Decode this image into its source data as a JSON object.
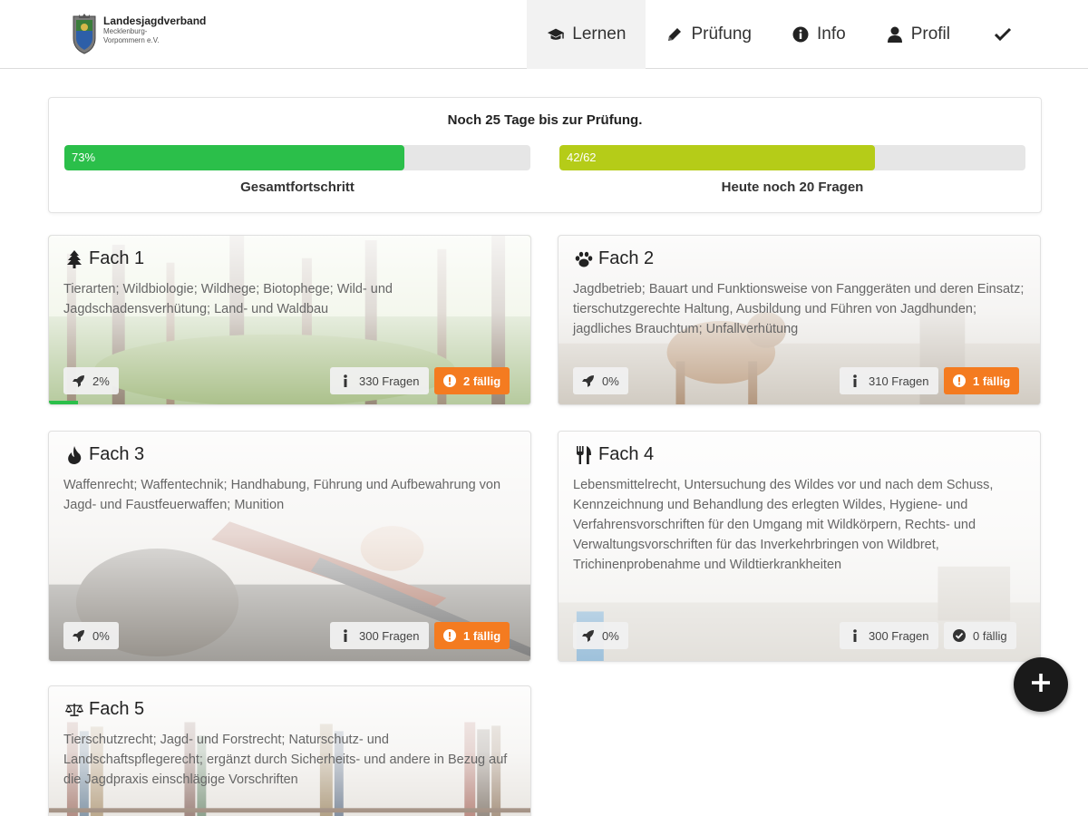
{
  "header": {
    "logo_title": "Landesjagdverband",
    "logo_sub_1": "Mecklenburg-",
    "logo_sub_2": "Vorpommern e.V.",
    "nav": [
      {
        "label": "Lernen",
        "icon": "graduation-cap-icon",
        "active": true
      },
      {
        "label": "Prüfung",
        "icon": "pencil-icon"
      },
      {
        "label": "Info",
        "icon": "info-circle-icon"
      },
      {
        "label": "Profil",
        "icon": "user-icon"
      }
    ],
    "check_icon": "check-icon"
  },
  "status": {
    "title": "Noch 25 Tage bis zur Prüfung.",
    "overall": {
      "text": "73%",
      "fraction": 0.73,
      "label": "Gesamtfortschritt",
      "color": "#2bbf4a"
    },
    "today": {
      "text": "42/62",
      "fraction": 0.677,
      "label": "Heute noch 20 Fragen",
      "color": "#b5cc18"
    }
  },
  "cards": [
    {
      "title": "Fach 1",
      "icon": "tree-icon",
      "desc": "Tierarten; Wildbiologie; Wildhege; Biotophege; Wild- und Jagdschadensverhütung; Land- und Waldbau",
      "progress": "2%",
      "progress_fraction": 0.02,
      "questions": "330 Fragen",
      "due": "2 fällig",
      "due_state": "warn",
      "bg": "forest"
    },
    {
      "title": "Fach 2",
      "icon": "paw-icon",
      "desc": "Jagdbetrieb; Bauart und Funktionsweise von Fanggeräten und deren Einsatz; tierschutzgerechte Haltung, Ausbildung und Führen von Jagdhunden; jagdliches Brauchtum; Unfallverhütung",
      "progress": "0%",
      "progress_fraction": 0,
      "questions": "310 Fragen",
      "due": "1 fällig",
      "due_state": "warn",
      "bg": "dog"
    },
    {
      "title": "Fach 3",
      "icon": "fire-icon",
      "desc": "Waffenrecht; Waffentechnik; Handhabung, Führung und Aufbewahrung von Jagd- und Faustfeuerwaffen; Munition",
      "progress": "0%",
      "progress_fraction": 0,
      "questions": "300 Fragen",
      "due": "1 fällig",
      "due_state": "warn",
      "bg": "rifle"
    },
    {
      "title": "Fach 4",
      "icon": "cutlery-icon",
      "desc": "Lebensmittelrecht, Untersuchung des Wildes vor und nach dem Schuss, Kennzeichnung und Behandlung des erlegten Wildes, Hygiene- und Verfahrensvorschriften für den Umgang mit Wildkörpern, Rechts- und Verwaltungsvorschriften für das Inverkehrbringen von Wildbret, Trichinenprobenahme und Wildtierkrankheiten",
      "progress": "0%",
      "progress_fraction": 0,
      "questions": "300 Fragen",
      "due": "0 fällig",
      "due_state": "ok",
      "bg": "kitchen"
    },
    {
      "title": "Fach 5",
      "icon": "balance-scale-icon",
      "desc": "Tierschutzrecht; Jagd- und Forstrecht; Naturschutz- und Landschaftspflegerecht; ergänzt durch Sicherheits- und andere in Bezug auf die Jagdpraxis einschlägige Vorschriften",
      "progress": "",
      "progress_fraction": 0,
      "questions": "",
      "due": "",
      "due_state": "",
      "bg": "library"
    }
  ],
  "fab_icon": "plus-icon"
}
